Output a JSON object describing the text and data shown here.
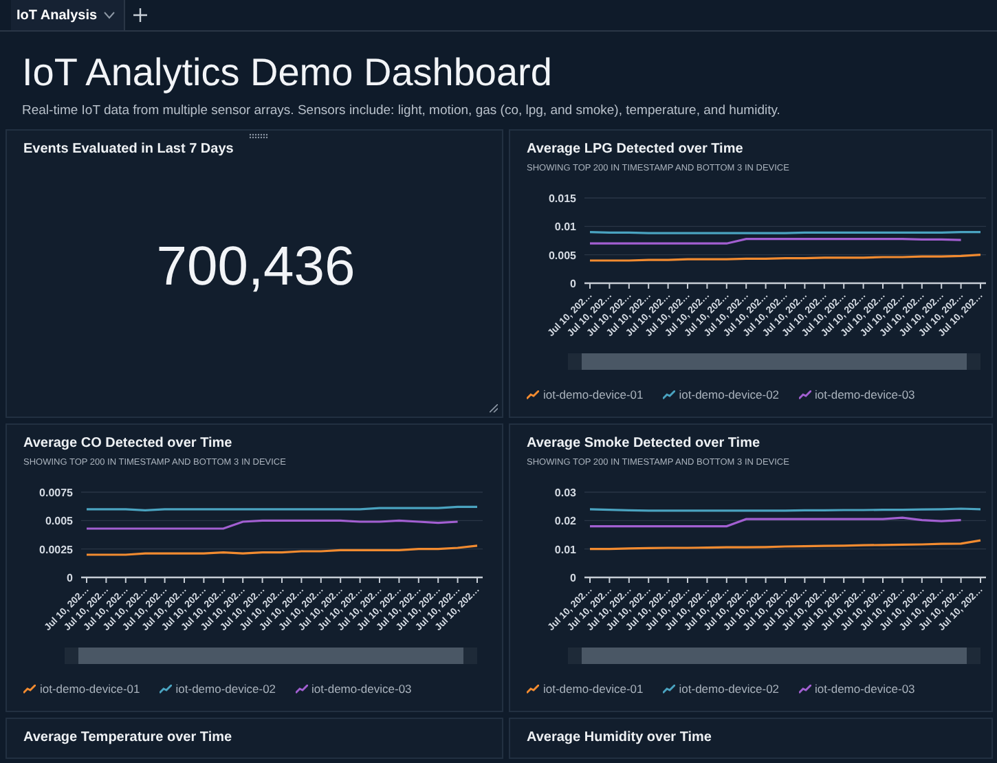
{
  "tabs": [
    {
      "label": "IoT Analysis",
      "selected": true
    }
  ],
  "title": "IoT Analytics Demo Dashboard",
  "description": "Real-time IoT data from multiple sensor arrays. Sensors include: light, motion, gas (co, lpg, and smoke), temperature, and humidity.",
  "kpi": {
    "title": "Events Evaluated in Last 7 Days",
    "value": "700,436"
  },
  "charts": [
    {
      "title": "Average LPG Detected over Time",
      "subtitle": "SHOWING TOP 200 IN TIMESTAMP AND BOTTOM 3 IN DEVICE",
      "chart_data": {
        "type": "line",
        "legend": "bottom",
        "categories": [
          "Jul 10, 202…",
          "Jul 10, 202…",
          "Jul 10, 202…",
          "Jul 10, 202…",
          "Jul 10, 202…",
          "Jul 10, 202…",
          "Jul 10, 202…",
          "Jul 10, 202…",
          "Jul 10, 202…",
          "Jul 10, 202…",
          "Jul 10, 202…",
          "Jul 10, 202…",
          "Jul 10, 202…",
          "Jul 10, 202…",
          "Jul 10, 202…",
          "Jul 10, 202…",
          "Jul 10, 202…",
          "Jul 10, 202…",
          "Jul 10, 202…",
          "Jul 10, 202…",
          "Jul 10, 202…"
        ],
        "ylim": [
          0,
          0.015
        ],
        "yticks": [
          0,
          0.005,
          0.01,
          0.015
        ],
        "series": [
          {
            "name": "iot-demo-device-01",
            "color": "#f28b30",
            "values": [
              0.004,
              0.004,
              0.004,
              0.0041,
              0.0041,
              0.0042,
              0.0042,
              0.0042,
              0.0043,
              0.0043,
              0.0044,
              0.0044,
              0.0045,
              0.0045,
              0.0045,
              0.0046,
              0.0046,
              0.0047,
              0.0047,
              0.0048,
              0.005
            ]
          },
          {
            "name": "iot-demo-device-02",
            "color": "#4aa3c0",
            "values": [
              0.009,
              0.0089,
              0.0089,
              0.0088,
              0.0088,
              0.0088,
              0.0088,
              0.0088,
              0.0088,
              0.0088,
              0.0088,
              0.0089,
              0.0089,
              0.0089,
              0.0089,
              0.0089,
              0.0089,
              0.0089,
              0.0089,
              0.009,
              0.009
            ]
          },
          {
            "name": "iot-demo-device-03",
            "color": "#a25fd1",
            "values": [
              0.007,
              0.007,
              0.007,
              0.007,
              0.007,
              0.007,
              0.007,
              0.007,
              0.0078,
              0.0078,
              0.0078,
              0.0078,
              0.0078,
              0.0078,
              0.0078,
              0.0078,
              0.0078,
              0.0077,
              0.0077,
              0.0076,
              null
            ]
          }
        ]
      }
    },
    {
      "title": "Average CO Detected over Time",
      "subtitle": "SHOWING TOP 200 IN TIMESTAMP AND BOTTOM 3 IN DEVICE",
      "chart_data": {
        "type": "line",
        "legend": "bottom",
        "categories": [
          "Jul 10, 202…",
          "Jul 10, 202…",
          "Jul 10, 202…",
          "Jul 10, 202…",
          "Jul 10, 202…",
          "Jul 10, 202…",
          "Jul 10, 202…",
          "Jul 10, 202…",
          "Jul 10, 202…",
          "Jul 10, 202…",
          "Jul 10, 202…",
          "Jul 10, 202…",
          "Jul 10, 202…",
          "Jul 10, 202…",
          "Jul 10, 202…",
          "Jul 10, 202…",
          "Jul 10, 202…",
          "Jul 10, 202…",
          "Jul 10, 202…",
          "Jul 10, 202…",
          "Jul 10, 202…"
        ],
        "ylim": [
          0,
          0.0075
        ],
        "yticks": [
          0,
          0.0025,
          0.005,
          0.0075
        ],
        "series": [
          {
            "name": "iot-demo-device-01",
            "color": "#f28b30",
            "values": [
              0.002,
              0.002,
              0.002,
              0.0021,
              0.0021,
              0.0021,
              0.0021,
              0.0022,
              0.0021,
              0.0022,
              0.0022,
              0.0023,
              0.0023,
              0.0024,
              0.0024,
              0.0024,
              0.0024,
              0.0025,
              0.0025,
              0.0026,
              0.0028
            ]
          },
          {
            "name": "iot-demo-device-02",
            "color": "#4aa3c0",
            "values": [
              0.006,
              0.006,
              0.006,
              0.0059,
              0.006,
              0.006,
              0.006,
              0.006,
              0.006,
              0.006,
              0.006,
              0.006,
              0.006,
              0.006,
              0.006,
              0.0061,
              0.0061,
              0.0061,
              0.0061,
              0.0062,
              0.0062
            ]
          },
          {
            "name": "iot-demo-device-03",
            "color": "#a25fd1",
            "values": [
              0.0043,
              0.0043,
              0.0043,
              0.0043,
              0.0043,
              0.0043,
              0.0043,
              0.0043,
              0.0049,
              0.005,
              0.005,
              0.005,
              0.005,
              0.005,
              0.0049,
              0.0049,
              0.005,
              0.0049,
              0.0048,
              0.0049,
              null
            ]
          }
        ]
      }
    },
    {
      "title": "Average Smoke Detected over Time",
      "subtitle": "SHOWING TOP 200 IN TIMESTAMP AND BOTTOM 3 IN DEVICE",
      "chart_data": {
        "type": "line",
        "legend": "bottom",
        "categories": [
          "Jul 10, 202…",
          "Jul 10, 202…",
          "Jul 10, 202…",
          "Jul 10, 202…",
          "Jul 10, 202…",
          "Jul 10, 202…",
          "Jul 10, 202…",
          "Jul 10, 202…",
          "Jul 10, 202…",
          "Jul 10, 202…",
          "Jul 10, 202…",
          "Jul 10, 202…",
          "Jul 10, 202…",
          "Jul 10, 202…",
          "Jul 10, 202…",
          "Jul 10, 202…",
          "Jul 10, 202…",
          "Jul 10, 202…",
          "Jul 10, 202…",
          "Jul 10, 202…",
          "Jul 10, 202…"
        ],
        "ylim": [
          0,
          0.03
        ],
        "yticks": [
          0,
          0.01,
          0.02,
          0.03
        ],
        "series": [
          {
            "name": "iot-demo-device-01",
            "color": "#f28b30",
            "values": [
              0.01,
              0.01,
              0.0102,
              0.0103,
              0.0104,
              0.0104,
              0.0105,
              0.0106,
              0.0106,
              0.0107,
              0.0109,
              0.011,
              0.0111,
              0.0112,
              0.0113,
              0.0114,
              0.0115,
              0.0116,
              0.0118,
              0.0119,
              0.013
            ]
          },
          {
            "name": "iot-demo-device-02",
            "color": "#4aa3c0",
            "values": [
              0.024,
              0.0238,
              0.0236,
              0.0235,
              0.0235,
              0.0235,
              0.0235,
              0.0235,
              0.0235,
              0.0235,
              0.0235,
              0.0236,
              0.0236,
              0.0237,
              0.0237,
              0.0238,
              0.0238,
              0.0239,
              0.024,
              0.0242,
              0.024
            ]
          },
          {
            "name": "iot-demo-device-03",
            "color": "#a25fd1",
            "values": [
              0.018,
              0.018,
              0.018,
              0.018,
              0.018,
              0.018,
              0.018,
              0.018,
              0.0205,
              0.0205,
              0.0205,
              0.0205,
              0.0205,
              0.0205,
              0.0205,
              0.0205,
              0.021,
              0.0202,
              0.0198,
              0.0202,
              null
            ]
          }
        ]
      }
    }
  ],
  "bottom_titles": [
    "Average Temperature over Time",
    "Average Humidity over Time"
  ]
}
